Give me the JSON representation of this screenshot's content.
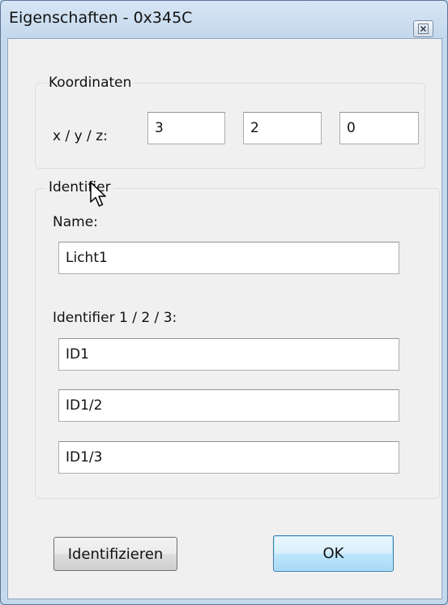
{
  "window": {
    "title": "Eigenschaften - 0x345C"
  },
  "koordinaten": {
    "legend": "Koordinaten",
    "label": "x / y / z:",
    "x": "3",
    "y": "2",
    "z": "0"
  },
  "identifier": {
    "legend": "Identifier",
    "name_label": "Name:",
    "name_value": "Licht1",
    "ids_label": "Identifier 1 / 2 / 3:",
    "id1": "ID1",
    "id2": "ID1/2",
    "id3": "ID1/3"
  },
  "buttons": {
    "identify": "Identifizieren",
    "ok": "OK"
  },
  "icons": {
    "close": "close-icon",
    "cursor": "mouse-pointer-icon"
  }
}
